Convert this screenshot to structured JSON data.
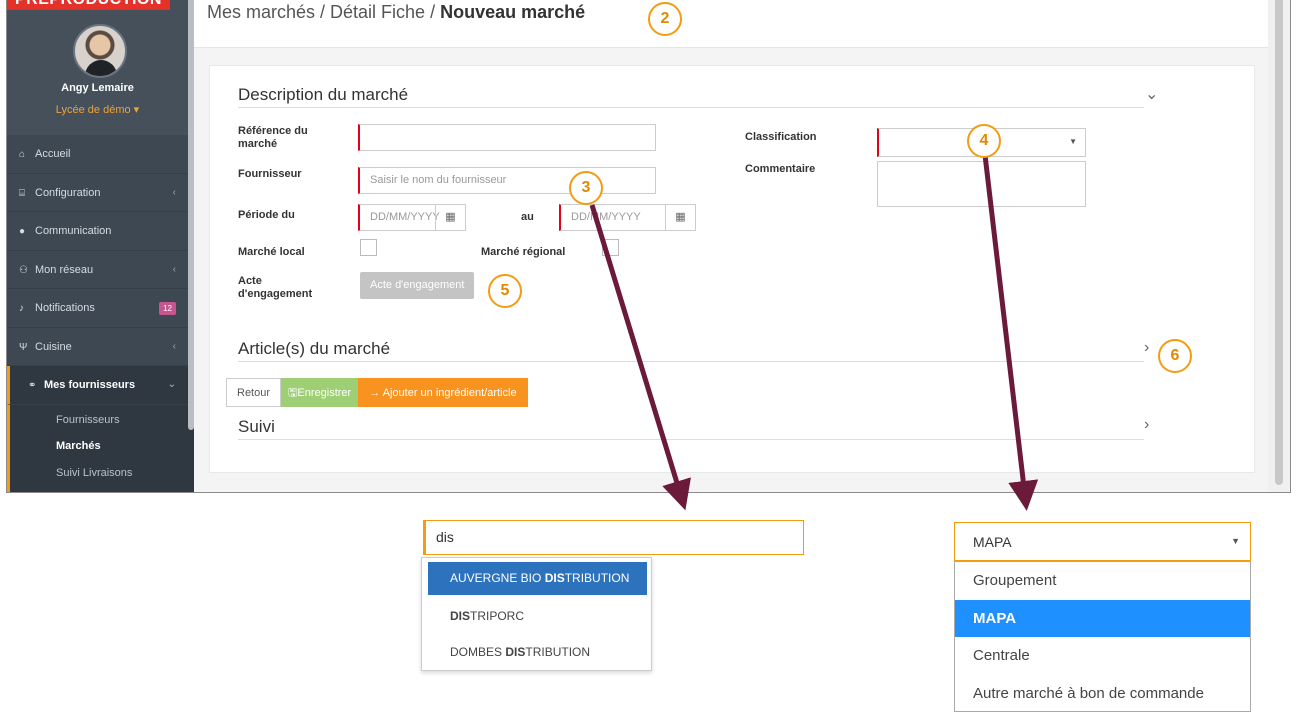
{
  "banner": "PREPRODUCTION",
  "sidebar": {
    "user_name": "Angy Lemaire",
    "school": "Lycée de démo ▾",
    "items": [
      {
        "label": "Accueil",
        "icon": "home-icon"
      },
      {
        "label": "Configuration",
        "icon": "bank-icon"
      },
      {
        "label": "Communication",
        "icon": "chat-icon"
      },
      {
        "label": "Mon réseau",
        "icon": "network-icon"
      },
      {
        "label": "Notifications",
        "icon": "bell-icon",
        "badge": "12"
      },
      {
        "label": "Cuisine",
        "icon": "cutlery-icon"
      },
      {
        "label": "Mes fournisseurs",
        "icon": "handshake-icon"
      }
    ],
    "subitems": [
      "Fournisseurs",
      "Marchés",
      "Suivi Livraisons"
    ]
  },
  "breadcrumb": {
    "path": "Mes marchés / Détail Fiche / ",
    "current": "Nouveau marché"
  },
  "form": {
    "section_description": "Description du marché",
    "ref_label_1": "Référence du",
    "ref_label_2": "marché",
    "fournisseur_label": "Fournisseur",
    "fournisseur_placeholder": "Saisir le nom du fournisseur",
    "periode_label": "Période du",
    "date_placeholder": "DD/MM/YYYY",
    "au_label": "au",
    "marche_local_label": "Marché local",
    "marche_regional_label": "Marché régional",
    "acte_label_1": "Acte",
    "acte_label_2": "d'engagement",
    "acte_button": "Acte d'engagement",
    "classification_label": "Classification",
    "commentaire_label": "Commentaire",
    "section_articles": "Article(s) du marché",
    "section_suivi": "Suivi",
    "btn_retour": "Retour",
    "btn_enregistrer": "🖫Enregistrer",
    "btn_ajouter": "→ Ajouter un ingrédient/article"
  },
  "steps": [
    "2",
    "3",
    "4",
    "5",
    "6"
  ],
  "search_callout": {
    "value": "dis",
    "results": [
      {
        "pre": "AUVERGNE BIO ",
        "match": "DIS",
        "post": "TRIBUTION",
        "highlighted": true
      },
      {
        "pre": "",
        "match": "DIS",
        "post": "TRIPORC",
        "highlighted": false
      },
      {
        "pre": "DOMBES ",
        "match": "DIS",
        "post": "TRIBUTION",
        "highlighted": false
      }
    ]
  },
  "classification_callout": {
    "selected": "MAPA",
    "options": [
      "Groupement",
      "MAPA",
      "Centrale",
      "Autre marché à bon de commande"
    ]
  },
  "colors": {
    "accent": "#f39c12",
    "arrow": "#6b1a3a",
    "required": "#e3001b",
    "highlight": "#2c72bd",
    "option_selected": "#1e90ff",
    "sidebar_bg": "#3e4852"
  }
}
